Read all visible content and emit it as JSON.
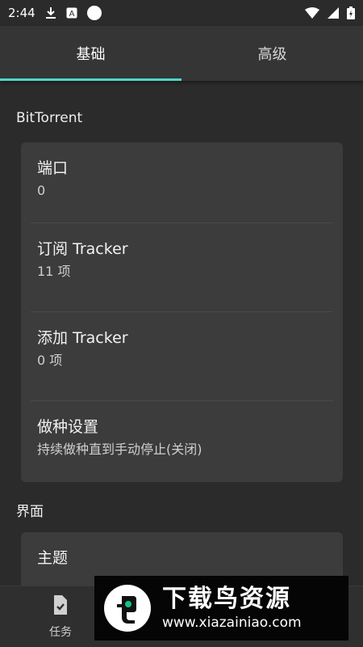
{
  "status_bar": {
    "time": "2:44",
    "icons": [
      "download-icon",
      "a-notification-icon",
      "circle-icon",
      "wifi-icon",
      "signal-icon",
      "battery-charging-icon"
    ]
  },
  "tabs": [
    {
      "label": "基础",
      "active": true
    },
    {
      "label": "高级",
      "active": false
    }
  ],
  "accent_color": "#4ed7c6",
  "sections": {
    "bittorrent": {
      "title": "BitTorrent",
      "items": [
        {
          "title": "端口",
          "value": "0"
        },
        {
          "title": "订阅 Tracker",
          "value": "11 项"
        },
        {
          "title": "添加 Tracker",
          "value": "0 项"
        },
        {
          "title": "做种设置",
          "value": "持续做种直到手动停止(关闭)"
        }
      ]
    },
    "interface": {
      "title": "界面",
      "items": [
        {
          "title": "主题"
        }
      ]
    }
  },
  "bottom_nav": {
    "tasks_label": "任务"
  },
  "watermark": {
    "title": "下载鸟资源",
    "url": "www.xiazainiao.com"
  }
}
